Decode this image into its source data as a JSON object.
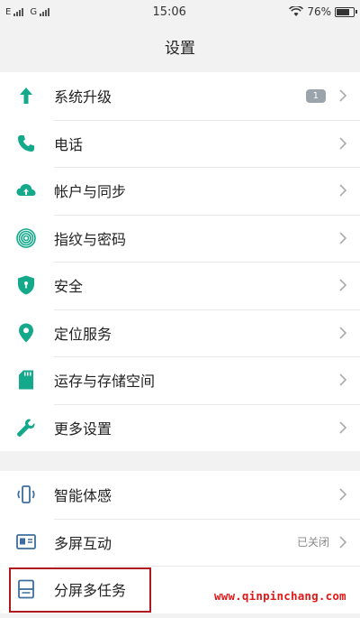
{
  "statusbar": {
    "carrier1": "E",
    "carrier2": "G",
    "time": "15:06",
    "battery_text": "76%",
    "battery_level": 0.76
  },
  "header": {
    "title": "设置"
  },
  "groups": [
    {
      "items": [
        {
          "label": "系统升级",
          "icon": "arrow-up-icon",
          "badge": "1"
        },
        {
          "label": "电话",
          "icon": "phone-icon"
        },
        {
          "label": "帐户与同步",
          "icon": "cloud-icon"
        },
        {
          "label": "指纹与密码",
          "icon": "fingerprint-icon"
        },
        {
          "label": "安全",
          "icon": "shield-icon"
        },
        {
          "label": "定位服务",
          "icon": "location-pin-icon"
        },
        {
          "label": "运存与存储空间",
          "icon": "sd-card-icon"
        },
        {
          "label": "更多设置",
          "icon": "wrench-icon"
        }
      ]
    },
    {
      "items": [
        {
          "label": "智能体感",
          "icon": "phone-motion-icon"
        },
        {
          "label": "多屏互动",
          "icon": "multi-screen-icon",
          "status": "已关闭"
        },
        {
          "label": "分屏多任务",
          "icon": "split-screen-icon"
        }
      ]
    }
  ],
  "watermark": "www.qinpinchang.com",
  "colors": {
    "accent_teal": "#13a98a",
    "icon_blue": "#3d6e9e",
    "highlight_red": "#b0181e",
    "watermark_red": "#e01818"
  }
}
